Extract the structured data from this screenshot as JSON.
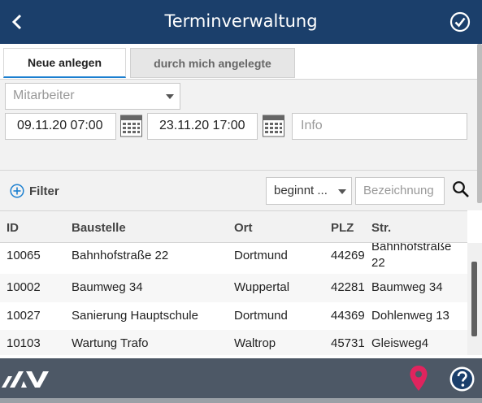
{
  "header": {
    "title": "Terminverwaltung",
    "back_icon": "chevron-left-icon",
    "confirm_icon": "check-circle-icon"
  },
  "tabs": [
    {
      "label": "Neue anlegen",
      "active": true
    },
    {
      "label": "durch mich angelegte",
      "active": false
    }
  ],
  "form": {
    "mitarbeiter_placeholder": "Mitarbeiter",
    "date_from": "09.11.20 07:00",
    "date_to": "23.11.20 17:00",
    "info_placeholder": "Info"
  },
  "filterbar": {
    "filter_label": "Filter",
    "sort_value": "beginnt ...",
    "bezeichnung_placeholder": "Bezeichnung"
  },
  "table": {
    "columns": [
      "ID",
      "Baustelle",
      "Ort",
      "PLZ",
      "Str."
    ],
    "rows": [
      {
        "id": "10065",
        "baustelle": "Bahnhofstraße 22",
        "ort": "Dortmund",
        "plz": "44269",
        "str_line1": "Bahnhofstraße",
        "str_line2": "22"
      },
      {
        "id": "10002",
        "baustelle": "Baumweg 34",
        "ort": "Wuppertal",
        "plz": "42281",
        "str_line1": "Baumweg 34",
        "str_line2": ""
      },
      {
        "id": "10027",
        "baustelle": "Sanierung Hauptschule",
        "ort": "Dortmund",
        "plz": "44369",
        "str_line1": "Dohlenweg 13",
        "str_line2": ""
      },
      {
        "id": "10103",
        "baustelle": "Wartung Trafo",
        "ort": "Waltrop",
        "plz": "45731",
        "str_line1": "Gleisweg4",
        "str_line2": ""
      }
    ]
  },
  "colors": {
    "header_bg": "#1b3f6b",
    "footer_bg": "#4d5866",
    "accent_blue": "#1b7fd0",
    "pin_red": "#e0245e"
  }
}
